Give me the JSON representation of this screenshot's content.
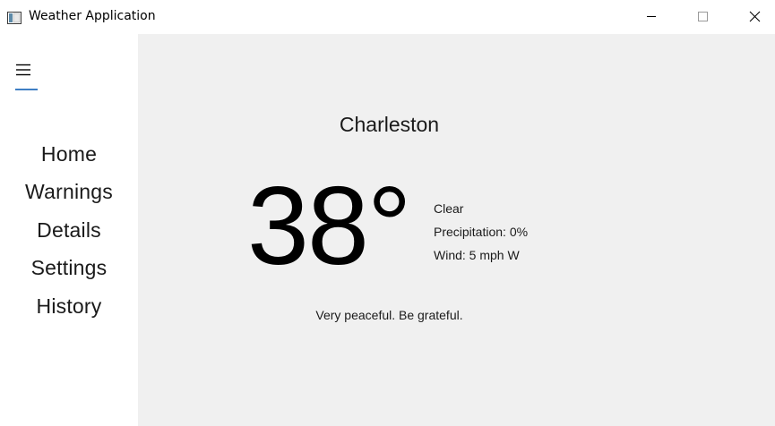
{
  "window": {
    "title": "Weather Application",
    "icon": "app-window-icon",
    "controls": [
      "minimize-icon",
      "maximize-icon",
      "close-icon"
    ]
  },
  "sidebar": {
    "menu_icon": "hamburger-menu-icon",
    "menu_glyph": "☰",
    "items": [
      {
        "label": "Home"
      },
      {
        "label": "Warnings"
      },
      {
        "label": "Details"
      },
      {
        "label": "Settings"
      },
      {
        "label": "History"
      }
    ]
  },
  "weather": {
    "city": "Charleston",
    "temperature": "38°",
    "condition": "Clear",
    "precipitation": "Precipitation: 0%",
    "wind": "Wind: 5 mph W",
    "message": "Very peaceful. Be grateful."
  },
  "colors": {
    "main_background": "#f0f0f0",
    "sidebar_background": "#ffffff",
    "accent": "#3f7fc4"
  }
}
